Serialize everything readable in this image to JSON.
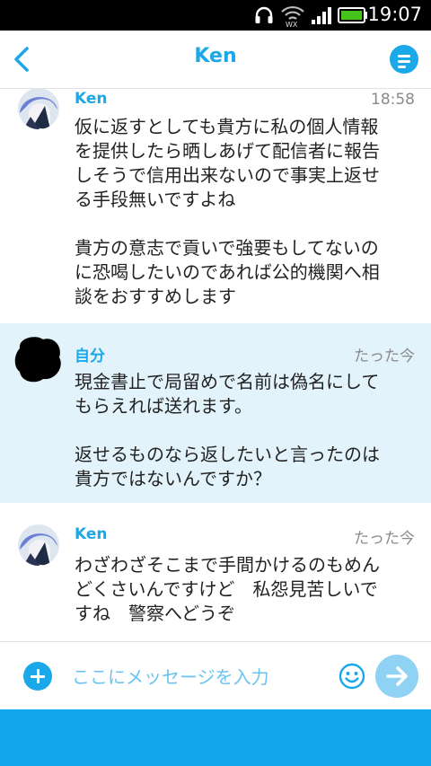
{
  "status_bar": {
    "time": "19:07"
  },
  "header": {
    "title": "Ken"
  },
  "messages": [
    {
      "sender": "Ken",
      "timestamp": "18:58",
      "text": "仮に返すとしても貴方に私の個人情報\nを提供したら晒しあげて配信者に報告\nしそうで信用出来ないので事実上返せ\nる手段無いですよね\n\n貴方の意志で貢いで強要もしてないの\nに恐喝したいのであれば公的機関へ相\n談をおすすめします"
    },
    {
      "sender": "自分",
      "timestamp": "たった今",
      "text": "現金書止で局留めで名前は偽名にして\nもらえれば送れます。\n\n返せるものなら返したいと言ったのは\n貴方ではないんですか？"
    },
    {
      "sender": "Ken",
      "timestamp": "たった今",
      "text": "わざわざそこまで手間かけるのもめん\nどくさいんですけど　私怨見苦しいで\nすね　警察へどうぞ"
    }
  ],
  "composer": {
    "placeholder": "ここにメッセージを入力"
  },
  "colors": {
    "accent": "#1aa8e8",
    "self_bg": "#e3f3fc",
    "send_btn": "#8fd2f4",
    "footer_bar": "#12a6ec"
  },
  "icons": {
    "back": "chevron-left-icon",
    "menu": "menu-icon",
    "add": "plus-icon",
    "emoji": "smiley-icon",
    "send": "arrow-right-icon"
  }
}
